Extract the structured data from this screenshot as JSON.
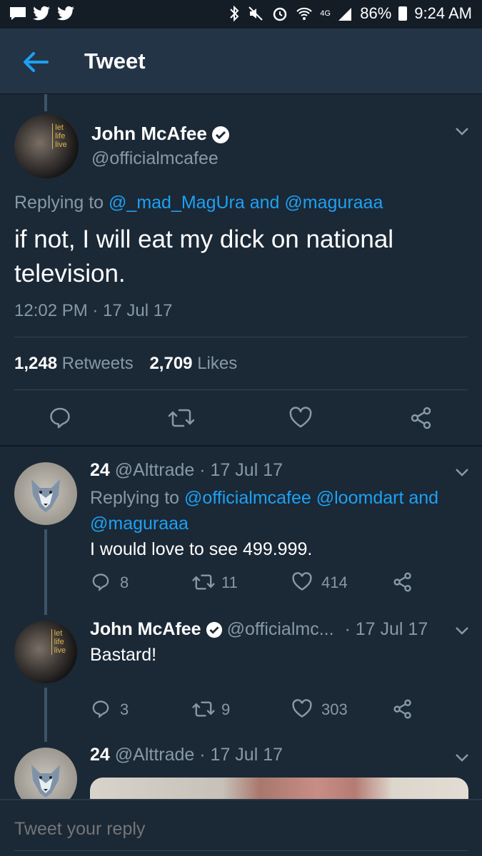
{
  "status_bar": {
    "battery": "86%",
    "time": "9:24 AM",
    "network": "4G"
  },
  "header": {
    "title": "Tweet"
  },
  "main_tweet": {
    "author": "John McAfee",
    "handle": "@officialmcafee",
    "avatar_text": [
      "let",
      "life",
      "live"
    ],
    "replying_prefix": "Replying to",
    "replying_user1": "@_mad_MagUra",
    "replying_and": "and",
    "replying_user2": "@maguraaa",
    "text": "if not, I will eat my dick on national television.",
    "timestamp": "12:02 PM · 17 Jul 17",
    "retweets_count": "1,248",
    "retweets_label": "Retweets",
    "likes_count": "2,709",
    "likes_label": "Likes"
  },
  "replies": [
    {
      "author": "24",
      "handle": "@Alttrade",
      "date": "· 17 Jul 17",
      "replying_prefix": "Replying to",
      "replying_users": "@officialmcafee @loomdart and",
      "replying_users2": "@maguraaa",
      "text": "I would love to see 499.999.",
      "reply_count": "8",
      "retweet_count": "11",
      "like_count": "414"
    },
    {
      "author": "John McAfee",
      "handle": "@officialmc...",
      "date": "· 17 Jul 17",
      "text": "Bastard!",
      "reply_count": "3",
      "retweet_count": "9",
      "like_count": "303"
    },
    {
      "author": "24",
      "handle": "@Alttrade",
      "date": "· 17 Jul 17"
    }
  ],
  "reply_bar": {
    "placeholder": "Tweet your reply"
  },
  "colors": {
    "background": "#1b2836",
    "header": "#243447",
    "accent": "#1da1f2",
    "muted": "#8899a6"
  }
}
